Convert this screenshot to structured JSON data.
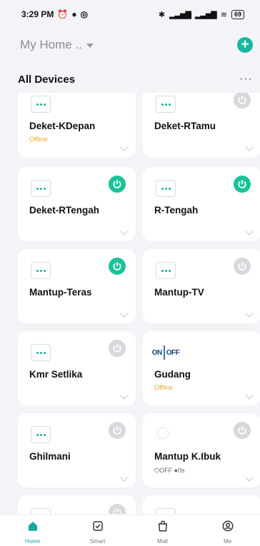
{
  "status_bar": {
    "time": "3:29 PM",
    "battery": "69"
  },
  "header": {
    "home_name": "My Home .."
  },
  "section": {
    "title": "All Devices"
  },
  "devices": [
    {
      "name": "Deket-KDepan",
      "status": "Offline",
      "power": "none",
      "icon": "device-dots-icon"
    },
    {
      "name": "Deket-RTamu",
      "status": "",
      "power": "off",
      "icon": "device-dots-icon"
    },
    {
      "name": "Deket-RTengah",
      "status": "",
      "power": "on",
      "icon": "device-dots-icon"
    },
    {
      "name": "R-Tengah",
      "status": "",
      "power": "on",
      "icon": "device-dots-icon"
    },
    {
      "name": "Mantup-Teras",
      "status": "",
      "power": "on",
      "icon": "device-dots-icon"
    },
    {
      "name": "Mantup-TV",
      "status": "",
      "power": "off",
      "icon": "device-dots-icon"
    },
    {
      "name": "Kmr Setlika",
      "status": "",
      "power": "off",
      "icon": "device-dots-icon"
    },
    {
      "name": "Gudang",
      "status": "Offline",
      "power": "none",
      "icon": "on-off-logo-icon",
      "logo_text_on": "ON",
      "logo_text_off": "OFF"
    },
    {
      "name": "Ghilmani",
      "status": "",
      "power": "off",
      "icon": "device-dots-icon"
    },
    {
      "name": "Mantup K.Ibuk",
      "status": "",
      "power": "off",
      "icon": "dotted-circle-icon",
      "sub": "⏻OFF ●0s"
    },
    {
      "name": "",
      "status": "",
      "power": "off",
      "icon": "device-dots-icon"
    },
    {
      "name": "",
      "status": "",
      "power": "none",
      "icon": "device-dots-icon"
    }
  ],
  "tabs": [
    {
      "label": "Home",
      "icon": "home-icon",
      "active": true
    },
    {
      "label": "Smart",
      "icon": "checkbox-icon",
      "active": false
    },
    {
      "label": "Mall",
      "icon": "shopping-bag-icon",
      "active": false
    },
    {
      "label": "Me",
      "icon": "profile-icon",
      "active": false
    }
  ],
  "colors": {
    "accent": "#19c397",
    "offline": "#e8a522",
    "tab_active": "#1aa6a0"
  }
}
